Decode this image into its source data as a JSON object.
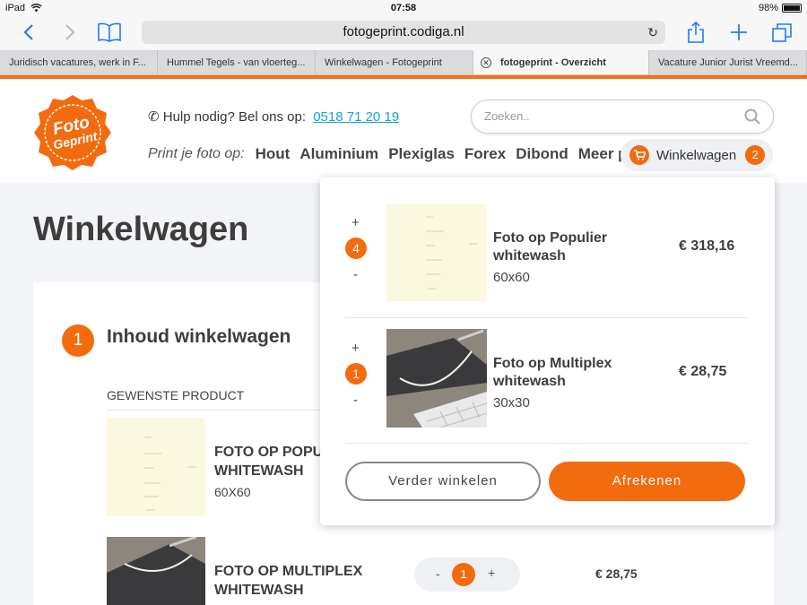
{
  "statusbar": {
    "device": "iPad",
    "time": "07:58",
    "battery": "98%"
  },
  "browser": {
    "url": "fotogeprint.codiga.nl",
    "tabs": [
      {
        "label": "Juridisch vacatures, werk in F..."
      },
      {
        "label": "Hummel Tegels - van vloerteg..."
      },
      {
        "label": "Winkelwagen - Fotogeprint"
      },
      {
        "label": "fotogeprint - Overzicht"
      },
      {
        "label": "Vacature Junior Jurist Vreemd..."
      }
    ]
  },
  "header": {
    "logo_text": "Foto Geprint",
    "help_text": "Hulp nodig? Bel ons op:",
    "phone": "0518 71 20 19",
    "search_placeholder": "Zoeken..",
    "nav_label": "Print je foto op:",
    "nav_items": [
      "Hout",
      "Aluminium",
      "Plexiglas",
      "Forex",
      "Dibond",
      "Meer prod"
    ],
    "cart_label": "Winkelwagen",
    "cart_count": "2"
  },
  "page": {
    "title": "Winkelwagen",
    "step_number": "1",
    "step_title": "Inhoud winkelwagen",
    "column_header": "GEWENSTE PRODUCT",
    "rows": [
      {
        "name_line1": "FOTO OP POPU",
        "name_line2": "WHITEWASH",
        "size": "60X60"
      },
      {
        "name_line1": "FOTO OP MULTIPLEX",
        "name_line2": "WHITEWASH",
        "quantity": "1",
        "minus": "-",
        "plus": "+",
        "price": "€ 28,75"
      }
    ]
  },
  "dropdown": {
    "items": [
      {
        "plus": "+",
        "quantity": "4",
        "minus": "-",
        "name_line1": "Foto op Populier",
        "name_line2": "whitewash",
        "size": "60x60",
        "price": "€ 318,16"
      },
      {
        "plus": "+",
        "quantity": "1",
        "minus": "-",
        "name_line1": "Foto op Multiplex",
        "name_line2": "whitewash",
        "size": "30x30",
        "price": "€ 28,75"
      }
    ],
    "continue_label": "Verder winkelen",
    "checkout_label": "Afrekenen"
  },
  "colors": {
    "accent": "#f26b0f",
    "link": "#1aa0d8",
    "tab_line": "#f47216"
  }
}
